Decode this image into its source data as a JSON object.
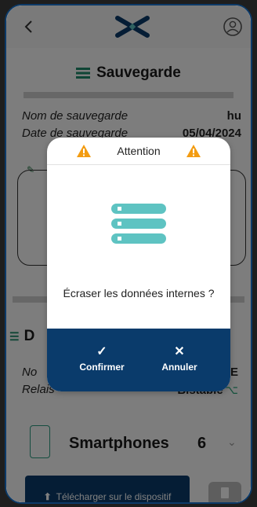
{
  "header": {
    "back_icon": "chevron-left-icon",
    "logo_icon": "brand-x-logo",
    "profile_icon": "user-circle-icon"
  },
  "page": {
    "title": "Sauvegarde",
    "fields": [
      {
        "label": "Nom de sauvegarde",
        "value": "hu"
      },
      {
        "label": "Date de sauvegarde",
        "value": "05/04/2024"
      }
    ],
    "section2_title": "D",
    "section2_rows": [
      {
        "label": "No",
        "value": "BE"
      },
      {
        "label": "Relais",
        "value": "Bistable"
      }
    ],
    "smartphones_label": "Smartphones",
    "smartphones_count": "6",
    "upload_button": "Télécharger sur le dispositif"
  },
  "dialog": {
    "title": "Attention",
    "message": "Écraser les données internes ?",
    "confirm_label": "Confirmer",
    "cancel_label": "Annuler",
    "colors": {
      "header_bg": "#0a3b6b",
      "accent_teal": "#5ec3c2",
      "warning": "#f39c12"
    }
  }
}
